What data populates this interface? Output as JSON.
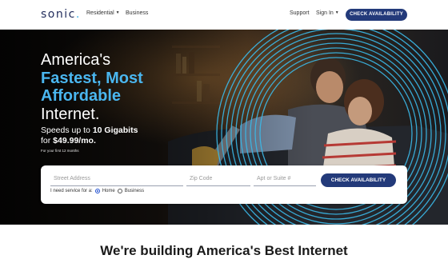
{
  "nav": {
    "logo": "sonic",
    "logo_dot": ".",
    "residential_label": "Residential",
    "business_label": "Business",
    "support_label": "Support",
    "signin_label": "Sign In",
    "cta_label": "CHECK AVAILABILITY"
  },
  "hero": {
    "headline_line1": "America's",
    "headline_line2": "Fastest, Most",
    "headline_line3": "Affordable",
    "headline_line4": "Internet.",
    "speeds_prefix": "Speeds up to ",
    "speeds_value": "10 Gigabits",
    "price_prefix": "for ",
    "price_value": "$49.99/mo.",
    "fineprint": "For your first 12 months"
  },
  "form": {
    "street_placeholder": "Street Address",
    "zip_placeholder": "Zip Code",
    "apt_placeholder": "Apt or Suite #",
    "cta_label": "CHECK AVAILABILITY",
    "service_label": "I need service for a:",
    "option_home": "Home",
    "option_business": "Business",
    "selected": "Home"
  },
  "below": {
    "title": "We're building America's Best Internet"
  },
  "colors": {
    "brand_navy": "#233a7a",
    "accent_blue": "#4ab6ef"
  }
}
